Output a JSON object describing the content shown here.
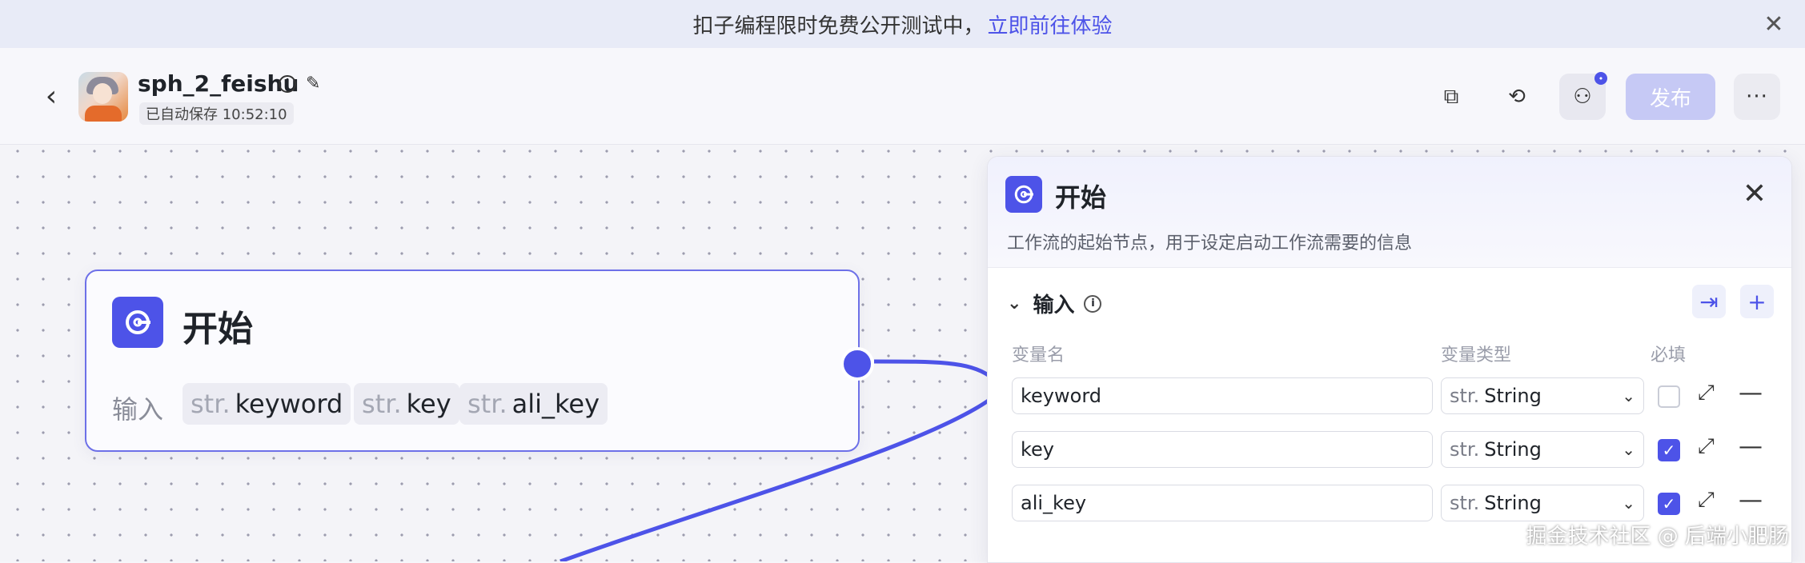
{
  "banner": {
    "text": "扣子编程限时免费公开测试中，",
    "link": "立即前往体验",
    "close": "✕"
  },
  "header": {
    "back": "‹",
    "app_name": "sph_2_feishu",
    "info": "i",
    "edit": "✎",
    "saved": "已自动保存 10:52:10",
    "copy_icon": "⧉",
    "history_icon": "⟲",
    "people_icon": "⚇",
    "badge": "•",
    "publish": "发布",
    "more": "···"
  },
  "node": {
    "title": "开始",
    "input_label": "输入",
    "params": [
      {
        "type": "str.",
        "name": "keyword"
      },
      {
        "type": "str.",
        "name": "key"
      },
      {
        "type": "str.",
        "name": "ali_key"
      }
    ]
  },
  "panel": {
    "title": "开始",
    "close": "✕",
    "description": "工作流的起始节点，用于设定启动工作流需要的信息",
    "section": {
      "title": "输入",
      "chevron": "⌄",
      "info": "i"
    },
    "import_btn": "⇥",
    "add_btn": "+",
    "columns": {
      "name": "变量名",
      "type": "变量类型",
      "required": "必填"
    },
    "rows": [
      {
        "name": "keyword",
        "type_prefix": "str.",
        "type": "String",
        "required": false,
        "check": "",
        "expand": "⤢",
        "remove": "—"
      },
      {
        "name": "key",
        "type_prefix": "str.",
        "type": "String",
        "required": true,
        "check": "✓",
        "expand": "⤢",
        "remove": "—"
      },
      {
        "name": "ali_key",
        "type_prefix": "str.",
        "type": "String",
        "required": true,
        "check": "✓",
        "expand": "⤢",
        "remove": "—"
      }
    ],
    "dropdown": "⌄"
  },
  "watermark": "掘金技术社区 @ 后端小肥肠",
  "colors": {
    "accent": "#4d53e8",
    "publish_disabled": "#c6c9f5"
  }
}
